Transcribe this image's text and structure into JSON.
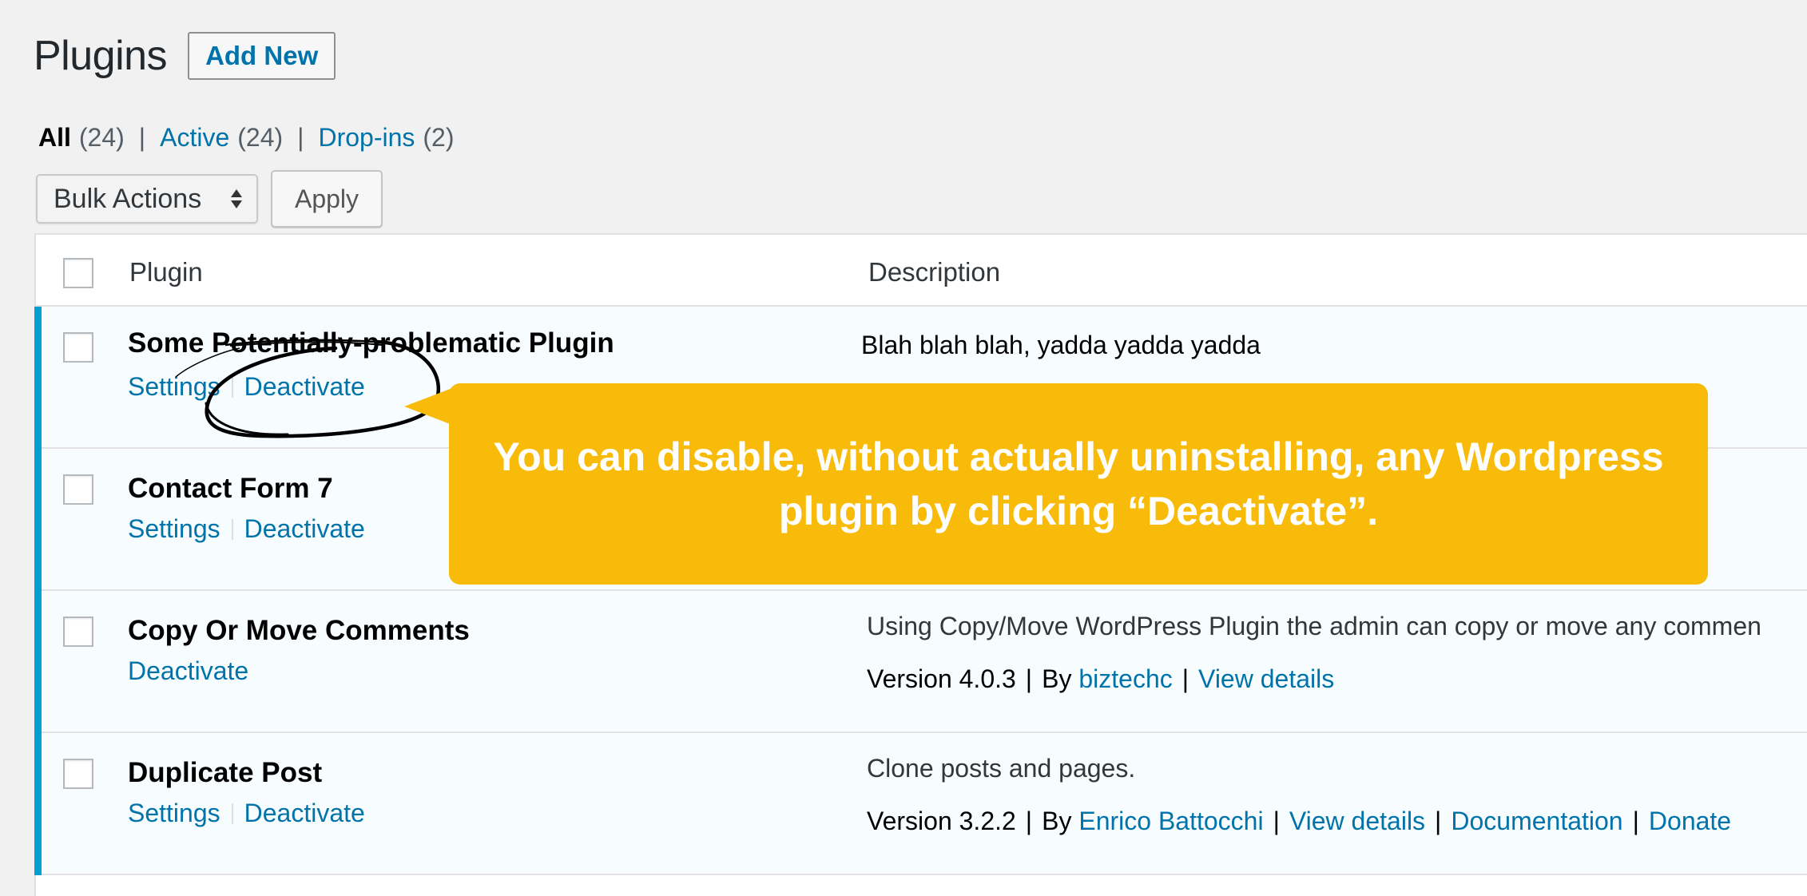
{
  "header": {
    "title": "Plugins",
    "add_new_label": "Add New"
  },
  "filters": {
    "all_label": "All",
    "all_count": "(24)",
    "active_label": "Active",
    "active_count": "(24)",
    "dropins_label": "Drop-ins",
    "dropins_count": "(2)",
    "separator": "|"
  },
  "tablenav": {
    "bulk_actions_value": "Bulk Actions",
    "apply_label": "Apply"
  },
  "table": {
    "columns": [
      "Plugin",
      "Description"
    ],
    "rows": [
      {
        "name": "Some Potentially-problematic Plugin",
        "actions": [
          "Settings",
          "Deactivate"
        ],
        "description": "Blah blah blah, yadda yadda yadda"
      },
      {
        "name": "Contact Form 7",
        "actions": [
          "Settings",
          "Deactivate"
        ],
        "description": ""
      },
      {
        "name": "Copy Or Move Comments",
        "actions": [
          "Deactivate"
        ],
        "description": "Using Copy/Move WordPress Plugin the admin can copy or move any commen",
        "version": "Version 4.0.3",
        "by": "By",
        "author": "biztechc",
        "links": [
          "View details"
        ]
      },
      {
        "name": "Duplicate Post",
        "actions": [
          "Settings",
          "Deactivate"
        ],
        "description": "Clone posts and pages.",
        "version": "Version 3.2.2",
        "by": "By",
        "author": "Enrico Battocchi",
        "links": [
          "View details",
          "Documentation",
          "Donate"
        ]
      }
    ]
  },
  "callout": {
    "line1": "You can disable, without actually uninstalling, any Wordpress",
    "line2": "plugin by clicking “Deactivate”."
  },
  "colors": {
    "link": "#0073aa",
    "active_bar": "#00a0d2",
    "callout_bg": "#f8bb0a",
    "row_bg": "#f7fcfe",
    "page_bg": "#f1f1f1"
  }
}
